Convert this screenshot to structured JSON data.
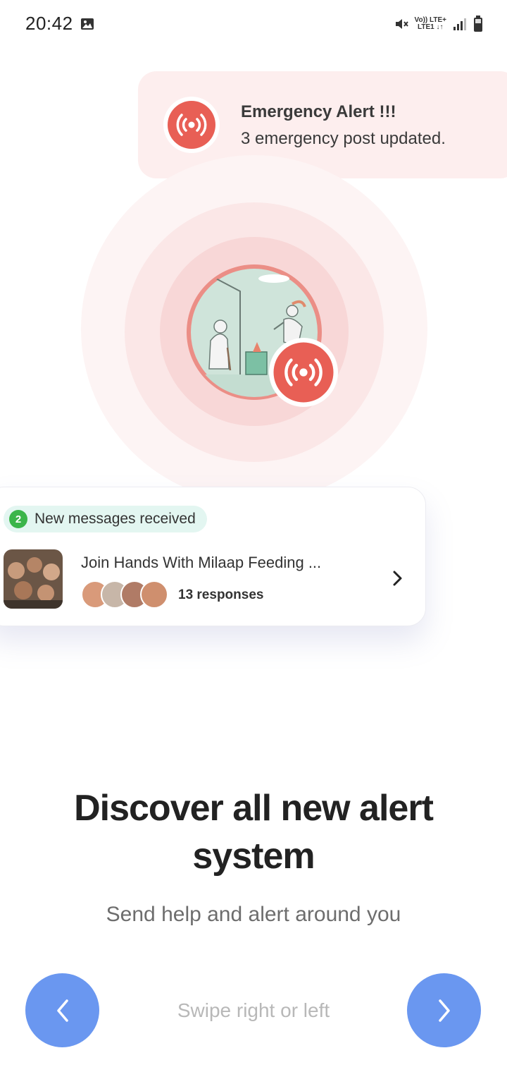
{
  "status_bar": {
    "time": "20:42",
    "net_top": "Vo)) LTE+",
    "net_bottom": "LTE1 ↓↑",
    "icons": [
      "gallery-icon",
      "mute-icon",
      "signal-icon",
      "battery-icon"
    ]
  },
  "alert": {
    "title": "Emergency Alert !!!",
    "subtitle": "3 emergency post updated.",
    "icon": "broadcast-icon"
  },
  "message_card": {
    "badge_count": "2",
    "badge_label": "New messages received",
    "title": "Join Hands With Milaap Feeding ...",
    "responses": "13 responses"
  },
  "onboarding": {
    "headline": "Discover all new alert system",
    "subtitle": "Send help and alert around you",
    "swipe_hint": "Swipe right or left"
  },
  "colors": {
    "accent_red": "#e85f55",
    "alert_bg": "#fdeeee",
    "nav_blue": "#6a97f0",
    "badge_green": "#3bb54a",
    "pill_bg": "#e3f6f1"
  }
}
